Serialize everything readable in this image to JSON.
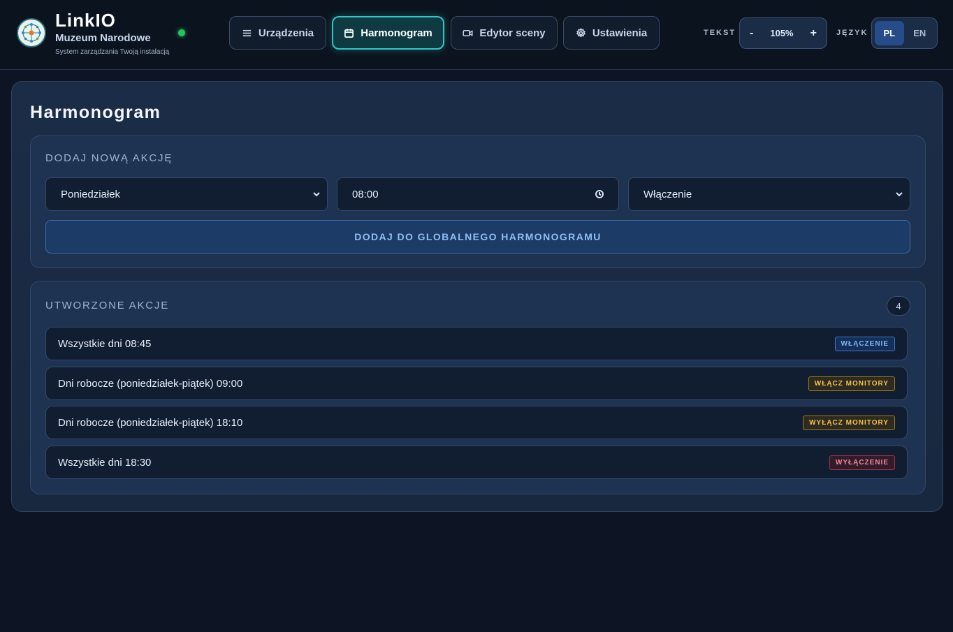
{
  "brand": {
    "title": "LinkIO",
    "subtitle": "Muzeum Narodowe",
    "description": "System zarządzania Twoją instalacją",
    "status_color": "#22c55e"
  },
  "nav": {
    "items": [
      {
        "label": "Urządzenia",
        "icon": "menu-icon"
      },
      {
        "label": "Harmonogram",
        "icon": "calendar-icon",
        "active": true
      },
      {
        "label": "Edytor sceny",
        "icon": "video-camera-icon"
      },
      {
        "label": "Ustawienia",
        "icon": "gear-icon"
      }
    ]
  },
  "controls": {
    "text_label": "TEKST",
    "zoom_minus": "-",
    "zoom_value": "105%",
    "zoom_plus": "+",
    "lang_label": "JĘZYK",
    "lang_pl": "PL",
    "lang_en": "EN",
    "active_lang": "PL"
  },
  "page": {
    "title": "Harmonogram"
  },
  "add_action": {
    "heading": "DODAJ NOWĄ AKCJĘ",
    "day_value": "Poniedziałek",
    "time_value": "08:00",
    "action_value": "Włączenie",
    "submit_label": "DODAJ DO GLOBALNEGO HARMONOGRAMU"
  },
  "created_actions": {
    "heading": "UTWORZONE AKCJE",
    "count": "4",
    "items": [
      {
        "text": "Wszystkie dni 08:45",
        "tag": "WŁĄCZENIE",
        "tag_type": "on"
      },
      {
        "text": "Dni robocze (poniedziałek-piątek) 09:00",
        "tag": "WŁĄCZ MONITORY",
        "tag_type": "mon-on"
      },
      {
        "text": "Dni robocze (poniedziałek-piątek) 18:10",
        "tag": "WYŁĄCZ MONITORY",
        "tag_type": "mon-off"
      },
      {
        "text": "Wszystkie dni 18:30",
        "tag": "WYŁĄCZENIE",
        "tag_type": "off"
      }
    ]
  },
  "colors": {
    "background": "#0d1524",
    "accent_teal": "#2fc6c4",
    "accent_blue": "#8cc0f5",
    "tag_yellow": "#f0c24a",
    "tag_red": "#f08a97"
  }
}
